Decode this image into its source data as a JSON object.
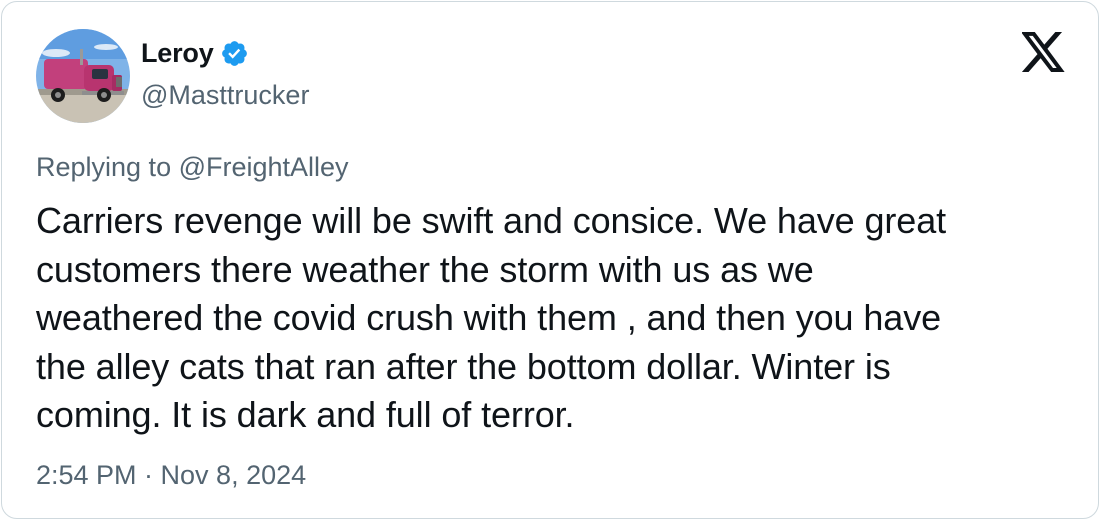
{
  "author": {
    "display_name": "Leroy",
    "handle": "@Masttrucker",
    "verified": true
  },
  "reply": {
    "prefix": "Replying to ",
    "mention": "@FreightAlley"
  },
  "tweet": {
    "text": "Carriers revenge will be swift and consice. We have great\ncustomers there weather the storm with us as we\nweathered the covid crush with them , and then you have\nthe alley cats that ran after the bottom dollar. Winter is\ncoming. It is dark and full of terror."
  },
  "meta": {
    "timestamp": "2:54 PM · Nov 8, 2024"
  },
  "icons": {
    "verified": "verified-badge-icon",
    "brand": "x-logo-icon"
  },
  "colors": {
    "text_primary": "#0f1419",
    "text_secondary": "#536471",
    "verified_blue": "#1d9bf0",
    "border": "#cfd9de"
  }
}
